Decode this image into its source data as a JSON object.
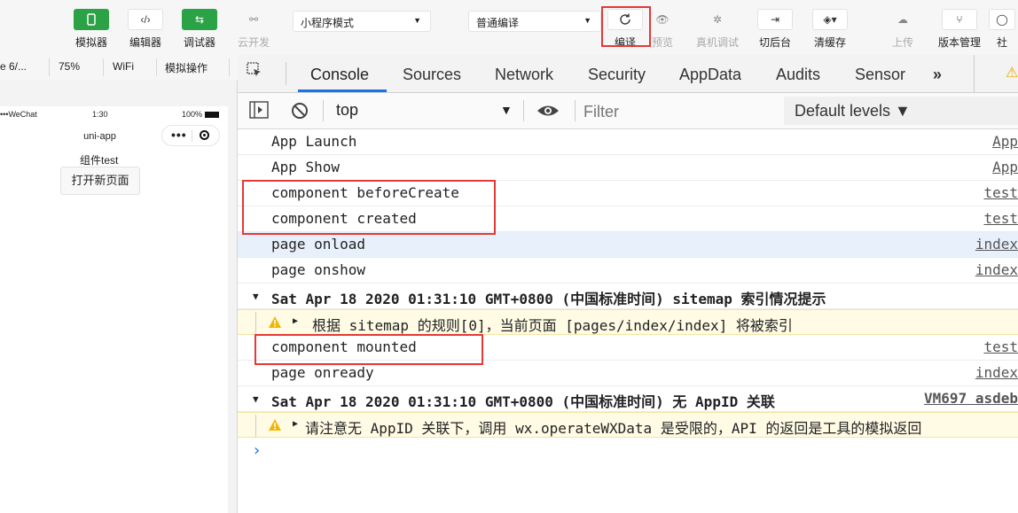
{
  "toolbar": {
    "buttons": [
      {
        "label": "模拟器"
      },
      {
        "label": "编辑器"
      },
      {
        "label": "调试器"
      },
      {
        "label": "云开发"
      },
      {
        "label": "编译"
      },
      {
        "label": "预览"
      },
      {
        "label": "真机调试"
      },
      {
        "label": "切后台"
      },
      {
        "label": "清缓存"
      },
      {
        "label": "上传"
      },
      {
        "label": "版本管理"
      },
      {
        "label": "社"
      }
    ],
    "mode_select": "小程序模式",
    "compile_select": "普通编译"
  },
  "sim_toolbar": {
    "device": "e 6/...",
    "zoom": "75%",
    "network": "WiFi",
    "ops": "模拟操作"
  },
  "simulator": {
    "carrier": "WeChat",
    "time": "1:30",
    "battery": "100%",
    "nav_title": "uni-app",
    "capsule_dots": "•••",
    "component_text": "组件test",
    "open_button": "打开新页面"
  },
  "devtools": {
    "tabs": [
      "Console",
      "Sources",
      "Network",
      "Security",
      "AppData",
      "Audits",
      "Sensor"
    ],
    "more_tabs": "»",
    "context": "top",
    "filter_placeholder": "Filter",
    "levels": "Default levels ▼",
    "logs": [
      {
        "msg": "App Launch",
        "src": "App"
      },
      {
        "msg": "App Show",
        "src": "App"
      },
      {
        "msg": "component beforeCreate",
        "src": "test"
      },
      {
        "msg": "component created",
        "src": "test"
      },
      {
        "msg": "page onload",
        "src": "index"
      },
      {
        "msg": "page onshow",
        "src": "index"
      },
      {
        "msg": "Sat Apr 18 2020 01:31:10 GMT+0800 (中国标准时间) sitemap 索引情况提示",
        "src": ""
      },
      {
        "msg": "根据 sitemap 的规则[0]，当前页面 [pages/index/index] 将被索引",
        "src": ""
      },
      {
        "msg": "component mounted",
        "src": "test"
      },
      {
        "msg": "page onready",
        "src": "index"
      },
      {
        "msg": "Sat Apr 18 2020 01:31:10 GMT+0800 (中国标准时间) 无 AppID 关联",
        "src": "VM697 asdeb"
      },
      {
        "msg": "请注意无 AppID 关联下，调用 wx.operateWXData 是受限的，API 的返回是工具的模拟返回",
        "src": ""
      }
    ],
    "prompt": "›"
  }
}
